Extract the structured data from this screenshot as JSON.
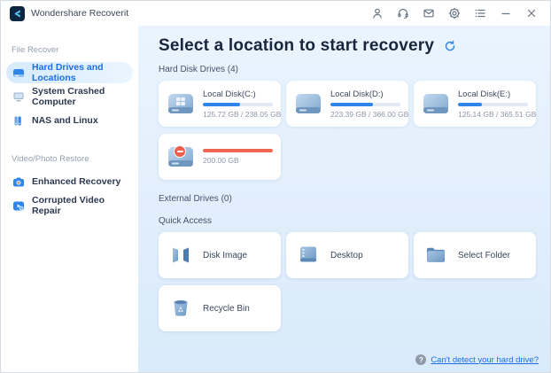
{
  "app": {
    "title": "Wondershare Recoverit"
  },
  "topbar": {
    "icons": [
      "account-icon",
      "support-headset-icon",
      "feedback-mail-icon",
      "settings-icon",
      "menu-list-icon",
      "minimize-icon",
      "close-icon"
    ]
  },
  "sidebar": {
    "sections": [
      {
        "label": "File Recover",
        "items": [
          {
            "label": "Hard Drives and Locations",
            "icon": "hard-drive-icon",
            "selected": true
          },
          {
            "label": "System Crashed Computer",
            "icon": "crashed-computer-icon",
            "selected": false
          },
          {
            "label": "NAS and Linux",
            "icon": "nas-server-icon",
            "selected": false
          }
        ]
      },
      {
        "label": "Video/Photo Restore",
        "items": [
          {
            "label": "Enhanced Recovery",
            "icon": "camera-icon",
            "selected": false
          },
          {
            "label": "Corrupted Video Repair",
            "icon": "video-repair-icon",
            "selected": false
          }
        ]
      }
    ]
  },
  "main": {
    "title": "Select a location to start recovery",
    "section_labels": {
      "hard_disk_drives": "Hard Disk Drives (4)",
      "external_drives": "External Drives (0)",
      "quick_access": "Quick Access"
    },
    "drives": [
      {
        "name": "Local Disk(C:)",
        "usage": "125.72 GB / 238.05 GB",
        "percent": 53,
        "bar_color": "#2f86e8",
        "badge": false
      },
      {
        "name": "Local Disk(D:)",
        "usage": "223.39 GB / 366.00 GB",
        "percent": 61,
        "bar_color": "#2f86e8",
        "badge": false
      },
      {
        "name": "Local Disk(E:)",
        "usage": "125.14 GB / 365.51 GB",
        "percent": 34,
        "bar_color": "#2f86e8",
        "badge": false
      },
      {
        "name": "",
        "usage": "200.00 GB",
        "percent": 100,
        "bar_color": "#f0654f",
        "badge": true
      }
    ],
    "quick_access": [
      {
        "label": "Disk Image",
        "icon": "disk-image-icon"
      },
      {
        "label": "Desktop",
        "icon": "desktop-icon"
      },
      {
        "label": "Select Folder",
        "icon": "folder-icon"
      },
      {
        "label": "Recycle Bin",
        "icon": "recycle-bin-icon"
      }
    ],
    "footer": {
      "help_question_mark": "?",
      "link": "Can't detect your hard drive?"
    }
  },
  "colors": {
    "accent_blue": "#1a6fe8",
    "bar_blue": "#2f86e8",
    "bar_red": "#f0654f",
    "track_gray": "#e3eaf2",
    "content_bg": "#e3effc",
    "logo_navy": "#0d2742"
  }
}
